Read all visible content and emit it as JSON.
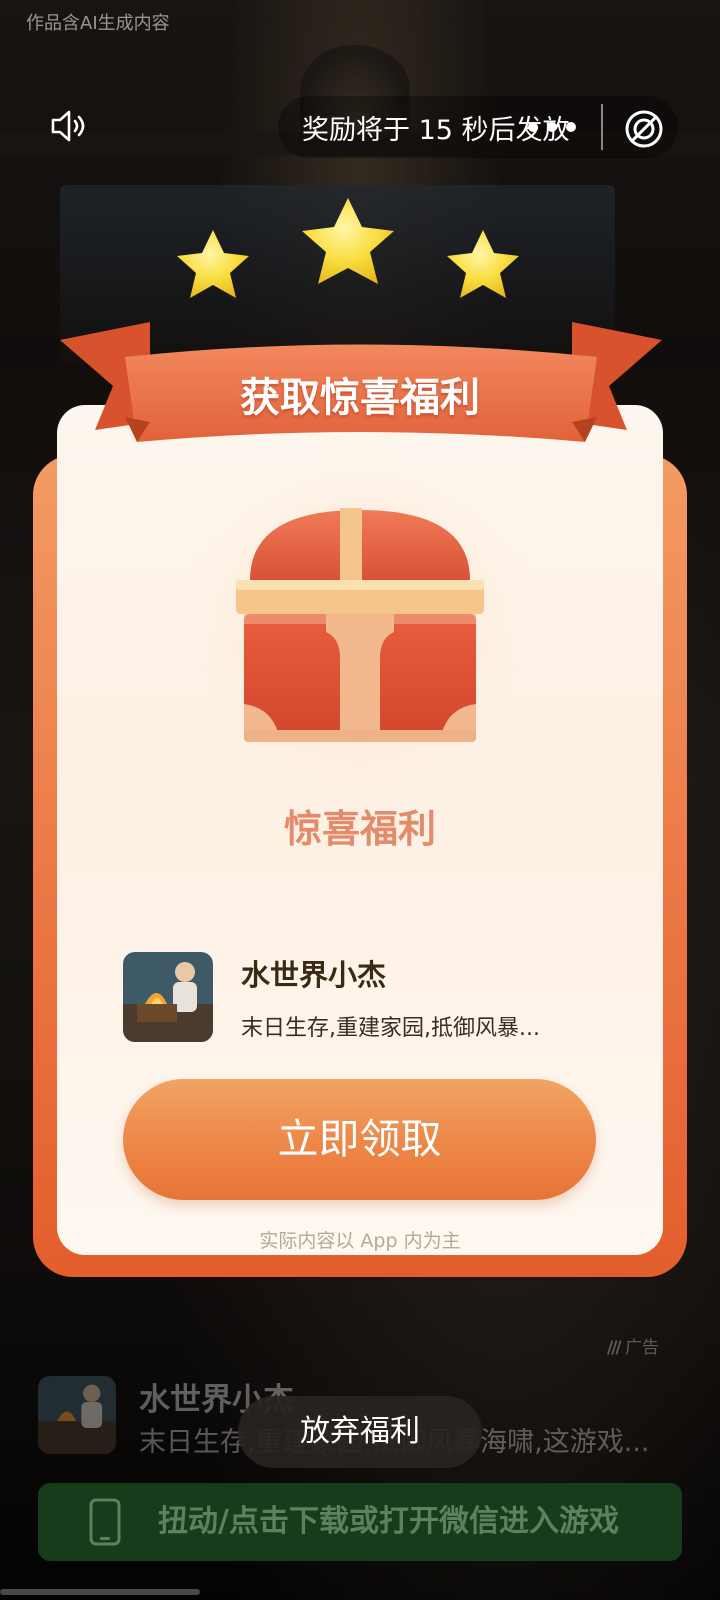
{
  "top": {
    "ai_notice": "作品含AI生成内容",
    "reward_countdown": "奖励将于 15 秒后发放"
  },
  "popup": {
    "ribbon_title": "获取惊喜福利",
    "center_title": "惊喜福利",
    "app": {
      "name": "水世界小杰",
      "description": "末日生存,重建家园,抵御风暴..."
    },
    "claim_button": "立即领取",
    "disclaimer": "实际内容以 App 内为主"
  },
  "ad_banner": {
    "app_name": "水世界小杰",
    "description": "末日生存,重建家园,抵御风暴海啸,这游戏...",
    "badge": "广告",
    "download_button": "扭动/点击下载或打开微信进入游戏"
  },
  "give_up_button": "放弃福利",
  "icons": [
    "speaker-icon",
    "more-dots-icon",
    "close-circle-icon",
    "star-icon",
    "treasure-chest-icon",
    "phone-icon",
    "ad-logo-icon"
  ],
  "colors": {
    "card_gradient_top": "#f39b62",
    "card_gradient_bottom": "#e45e2d",
    "card_inner": "#fdf6ee",
    "claim_button": "#ec8445",
    "center_title": "#e38b6a",
    "star_yellow": "#f7d63a",
    "download_bg": "#173c1c"
  }
}
